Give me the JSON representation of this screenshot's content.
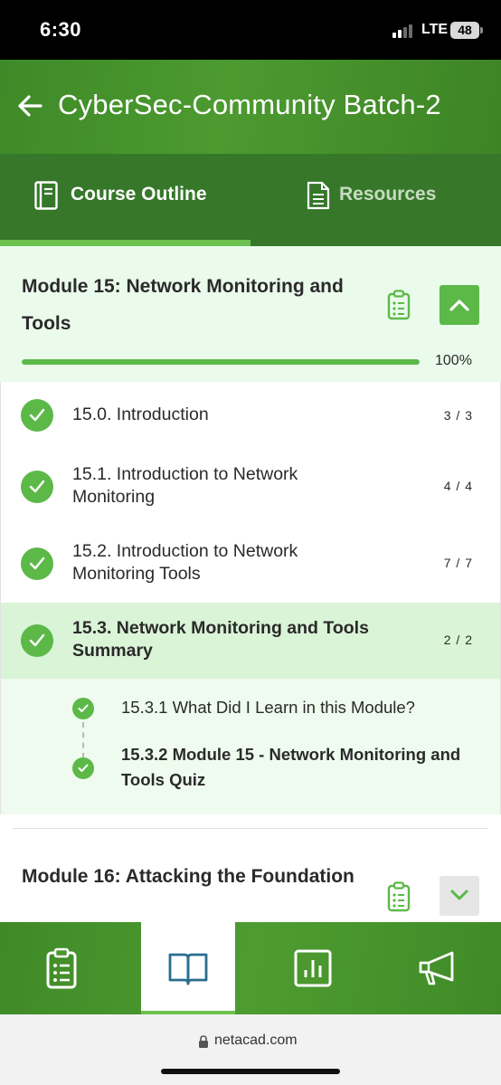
{
  "status_bar": {
    "time": "6:30",
    "network": "LTE",
    "battery": "48"
  },
  "header": {
    "back_icon": "arrow-left-icon",
    "title": "CyberSec-Community Batch-2"
  },
  "tabs": [
    {
      "label": "Course Outline",
      "icon": "book-icon",
      "active": true
    },
    {
      "label": "Resources",
      "icon": "document-icon",
      "active": false
    }
  ],
  "module15": {
    "title": "Module 15: Network Monitoring and Tools",
    "progress_label": "100%",
    "progress_fraction": 1.0,
    "lessons": [
      {
        "title": "15.0. Introduction",
        "count": "3 / 3"
      },
      {
        "title": "15.1. Introduction to Network Monitoring",
        "count": "4 / 4"
      },
      {
        "title": "15.2. Introduction to Network Monitoring Tools",
        "count": "7 / 7"
      },
      {
        "title": "15.3. Network Monitoring and Tools Summary",
        "count": "2 / 2"
      }
    ],
    "sub_items": [
      {
        "title": "15.3.1 What Did I Learn in this Module?"
      },
      {
        "title": "15.3.2 Module 15 - Network Monitoring and Tools Quiz"
      }
    ]
  },
  "module16": {
    "title": "Module 16: Attacking the Foundation"
  },
  "bottom_nav": [
    {
      "icon": "clipboard-icon",
      "active": false
    },
    {
      "icon": "open-book-icon",
      "active": true
    },
    {
      "icon": "bar-chart-icon",
      "active": false
    },
    {
      "icon": "megaphone-icon",
      "active": false
    }
  ],
  "url_bar": {
    "url": "netacad.com"
  },
  "colors": {
    "brand_green": "#4c9a30",
    "accent_green": "#5cb948",
    "active_row": "#d9f4d7",
    "module_bg": "#eafbec"
  }
}
